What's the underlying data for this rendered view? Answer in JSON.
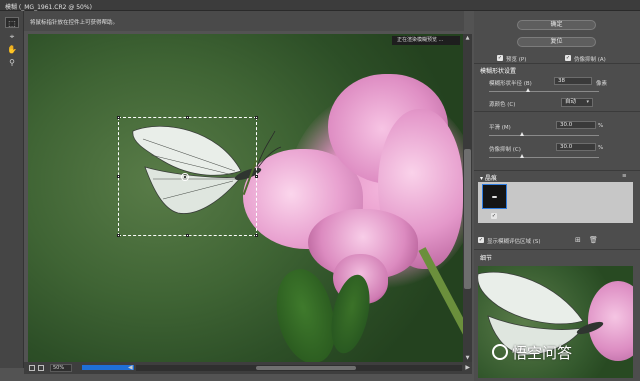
{
  "window": {
    "title": "模糊 (_MG_1961.CR2 @ 50%)"
  },
  "hint": "将鼠标指针放在控件上可获得帮助。",
  "canvas": {
    "render_status": "正在渲染模糊预览 ..."
  },
  "statusbar": {
    "zoom": "50%",
    "progress": 1.0
  },
  "buttons": {
    "ok": "确定",
    "reset": "复位"
  },
  "options": {
    "preview": "预览 (P)",
    "noise_suppress": "伪像抑制 (A)"
  },
  "motion_blur": {
    "heading": "模糊形状设置",
    "speed_label": "模糊形状半径 (B)",
    "speed_value": "38",
    "speed_unit": "像素",
    "source_label": "源颜色 (C)",
    "source_value": "自动",
    "smooth_label": "平滑 (M)",
    "smooth_value": "30.0",
    "smooth_unit": "%",
    "artifact_label": "伪像抑制 (C)",
    "artifact_value": "30.0",
    "artifact_unit": "%"
  },
  "traces": {
    "heading": "▾ 晶痕",
    "menu": "≡"
  },
  "show_traces": {
    "label": "显示模糊评估区域 (S)"
  },
  "navigator": {
    "heading": "细节"
  },
  "watermark": "悟空问答",
  "colors": {
    "accent": "#1f6fd8",
    "panel": "#4d4d4d",
    "canvas_bg": "#3f6434"
  }
}
